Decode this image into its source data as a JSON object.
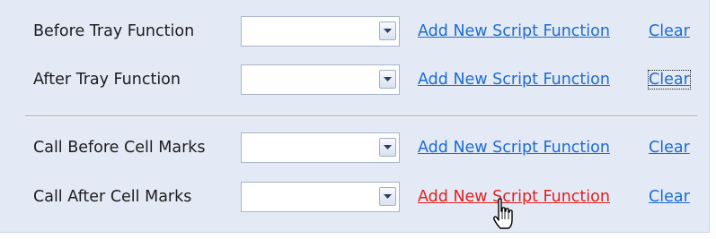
{
  "rows": [
    {
      "label": "Before Tray Function",
      "value": "",
      "add_link": "Add New Script Function",
      "clear_link": "Clear"
    },
    {
      "label": "After Tray Function",
      "value": "",
      "add_link": "Add New Script Function",
      "clear_link": "Clear"
    },
    {
      "label": "Call Before Cell Marks",
      "value": "",
      "add_link": "Add New Script Function",
      "clear_link": "Clear"
    },
    {
      "label": "Call After Cell Marks",
      "value": "",
      "add_link": "Add New Script Function",
      "clear_link": "Clear"
    }
  ],
  "colors": {
    "panel_bg": "#e3eaf6",
    "link": "#1d6bd2",
    "link_hover": "#e0201c"
  },
  "icons": {
    "dropdown": "chevron-down-icon",
    "cursor": "hand-pointer-icon"
  }
}
